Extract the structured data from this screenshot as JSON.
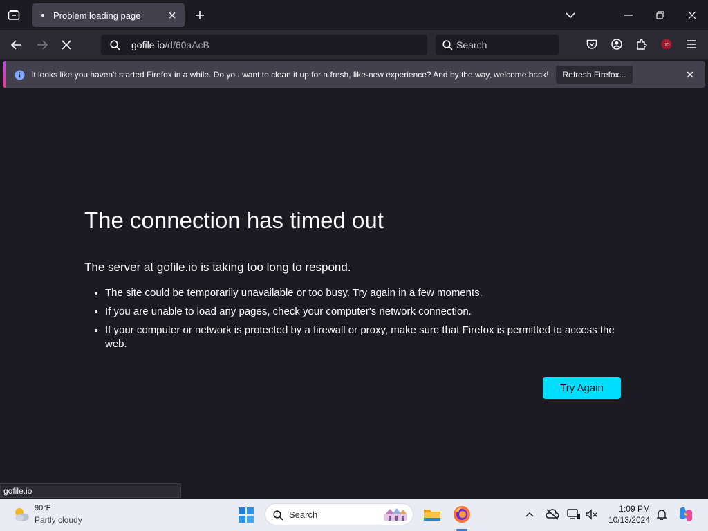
{
  "tab": {
    "title": "Problem loading page"
  },
  "url": {
    "host": "gofile.io",
    "path": "/d/60aAcB"
  },
  "searchbar": {
    "placeholder": "Search"
  },
  "notice": {
    "text": "It looks like you haven't started Firefox in a while. Do you want to clean it up for a fresh, like-new experience? And by the way, welcome back!",
    "button": "Refresh Firefox..."
  },
  "error": {
    "title": "The connection has timed out",
    "subtitle": "The server at gofile.io is taking too long to respond.",
    "bullets": [
      "The site could be temporarily unavailable or too busy. Try again in a few moments.",
      "If you are unable to load any pages, check your computer's network connection.",
      "If your computer or network is protected by a firewall or proxy, make sure that Firefox is permitted to access the web."
    ],
    "button": "Try Again"
  },
  "status": {
    "link": "gofile.io"
  },
  "taskbar": {
    "weather_temp": "90°F",
    "weather_desc": "Partly cloudy",
    "search": "Search",
    "time": "1:09 PM",
    "date": "10/13/2024"
  },
  "colors": {
    "accent": "#00ddff",
    "background": "#1c1b22",
    "toolbar": "#2b2a33"
  },
  "icons": [
    "list-all-tabs-icon",
    "close-tab-icon",
    "new-tab-icon",
    "tab-overflow-icon",
    "minimize-icon",
    "restore-icon",
    "window-close-icon",
    "back-icon",
    "forward-icon",
    "stop-loading-icon",
    "search-icon",
    "pocket-icon",
    "account-icon",
    "extensions-icon",
    "ublock-icon",
    "menu-icon",
    "info-icon",
    "close-icon",
    "weather-icon",
    "windows-start-icon",
    "file-explorer-icon",
    "firefox-icon",
    "chevron-up-icon",
    "network-icon",
    "display-icon",
    "volume-icon",
    "notification-bell-icon",
    "copilot-icon"
  ]
}
